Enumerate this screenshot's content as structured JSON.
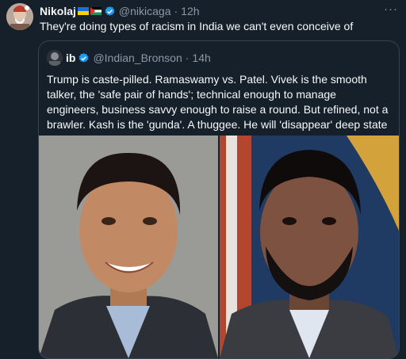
{
  "tweet": {
    "author_name": "Nikolaj",
    "flags": [
      "ukraine-flag",
      "palestine-flag"
    ],
    "handle": "@nikicaga",
    "separator": "·",
    "time": "12h",
    "text": "They're doing types of racism in India we can't even conceive of",
    "more_icon": "···"
  },
  "quote": {
    "author_name": "ib",
    "handle": "@Indian_Bronson",
    "separator": "·",
    "time": "14h",
    "text": "Trump is caste-pilled. Ramaswamy vs. Patel. Vivek is the smooth talker, the 'safe pair of hands'; technical enough to manage engineers, business savvy enough to raise a round. But refined, not a brawler. Kash is the 'gunda'. A thuggee. He will 'disappear' deep state traitors."
  },
  "colors": {
    "background": "#15202b",
    "verified": "#1d9bf0",
    "muted_text": "#8b98a5",
    "border": "#38444d"
  }
}
